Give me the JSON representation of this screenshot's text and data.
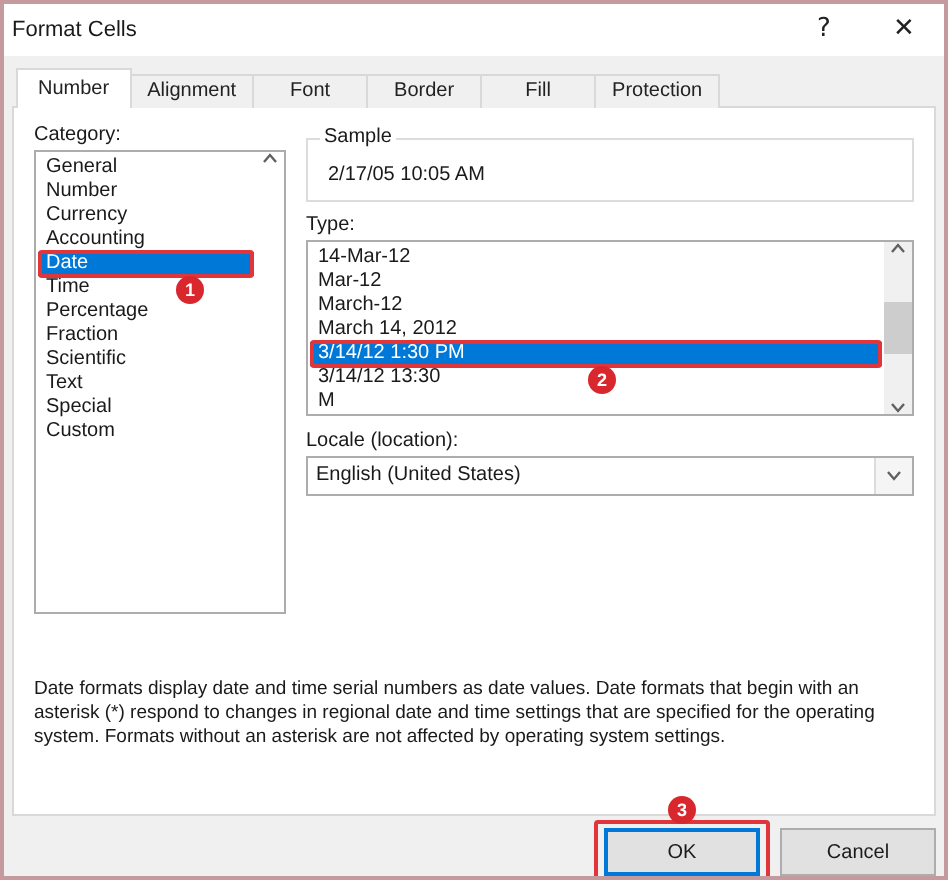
{
  "window": {
    "title": "Format Cells",
    "help": "?",
    "close": "✕"
  },
  "tabs": [
    {
      "label": "Number",
      "selected": true
    },
    {
      "label": "Alignment",
      "selected": false
    },
    {
      "label": "Font",
      "selected": false
    },
    {
      "label": "Border",
      "selected": false
    },
    {
      "label": "Fill",
      "selected": false
    },
    {
      "label": "Protection",
      "selected": false
    }
  ],
  "category": {
    "label": "Category:",
    "items": [
      {
        "label": "General",
        "selected": false
      },
      {
        "label": "Number",
        "selected": false
      },
      {
        "label": "Currency",
        "selected": false
      },
      {
        "label": "Accounting",
        "selected": false
      },
      {
        "label": "Date",
        "selected": true,
        "annotation": "1"
      },
      {
        "label": "Time",
        "selected": false
      },
      {
        "label": "Percentage",
        "selected": false
      },
      {
        "label": "Fraction",
        "selected": false
      },
      {
        "label": "Scientific",
        "selected": false
      },
      {
        "label": "Text",
        "selected": false
      },
      {
        "label": "Special",
        "selected": false
      },
      {
        "label": "Custom",
        "selected": false
      }
    ]
  },
  "sample": {
    "label": "Sample",
    "value": "2/17/05 10:05 AM"
  },
  "type": {
    "label": "Type:",
    "items": [
      {
        "label": "14-Mar-12",
        "selected": false
      },
      {
        "label": "Mar-12",
        "selected": false
      },
      {
        "label": "March-12",
        "selected": false
      },
      {
        "label": "March 14, 2012",
        "selected": false
      },
      {
        "label": "3/14/12 1:30 PM",
        "selected": true,
        "annotation": "2"
      },
      {
        "label": "3/14/12 13:30",
        "selected": false
      },
      {
        "label": "M",
        "selected": false
      }
    ]
  },
  "locale": {
    "label": "Locale (location):",
    "value": "English (United States)"
  },
  "description": "Date formats display date and time serial numbers as date values.  Date formats that begin with an asterisk (*) respond to changes in regional date and time settings that are specified for the operating system. Formats without an asterisk are not affected by operating system settings.",
  "buttons": [
    {
      "label": "OK",
      "kind": "default",
      "annotation": "3"
    },
    {
      "label": "Cancel",
      "kind": "normal"
    }
  ]
}
